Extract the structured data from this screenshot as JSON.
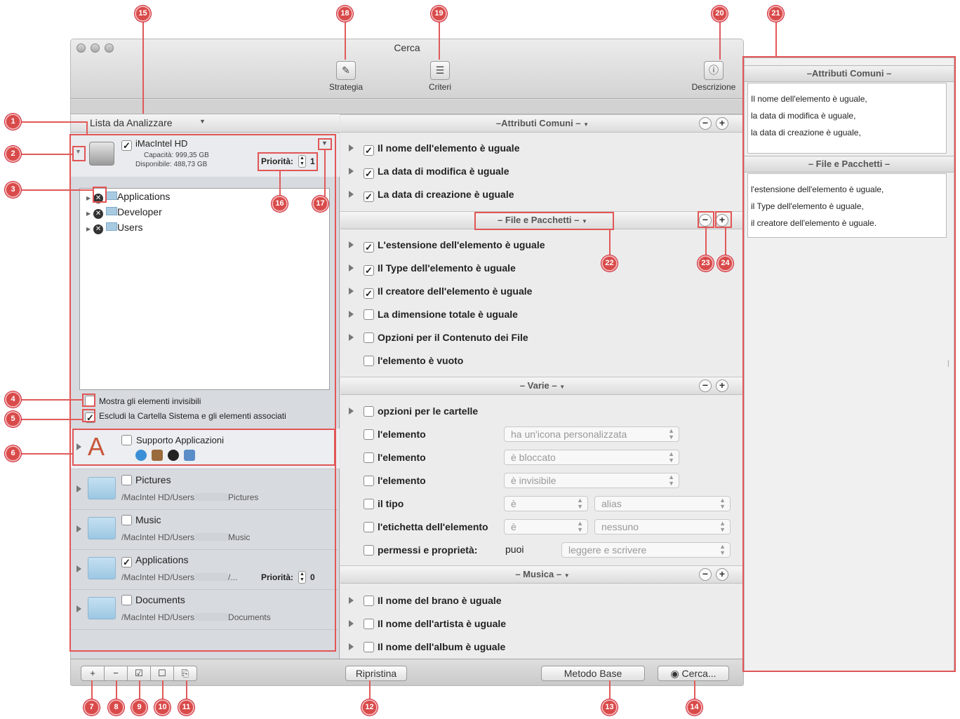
{
  "window": {
    "title": "Cerca"
  },
  "toolbar": {
    "strategia": "Strategia",
    "criteri": "Criteri",
    "descrizione": "Descrizione"
  },
  "left": {
    "header": "Lista da Analizzare",
    "volume": {
      "name": "iMacIntel HD",
      "capacity": "Capacità: 999,35 GB",
      "available": "Disponibile: 488,73 GB",
      "priority_label": "Priorità:",
      "priority_value": "1"
    },
    "tree": [
      {
        "label": "Applications"
      },
      {
        "label": "Developer"
      },
      {
        "label": "Users"
      }
    ],
    "show_invisible": "Mostra gli elementi invisibili",
    "exclude_system": "Escludi la Cartella Sistema e gli elementi associati",
    "support_apps": "Supporto Applicazioni",
    "folders": [
      {
        "name": "Pictures",
        "path_start": "/MacIntel HD/Users",
        "path_end": "Pictures",
        "checked": false
      },
      {
        "name": "Music",
        "path_start": "/MacIntel HD/Users",
        "path_end": "Music",
        "checked": false
      },
      {
        "name": "Applications",
        "path_start": "/MacIntel HD/Users",
        "path_end": "/...",
        "checked": true,
        "priority_label": "Priorità:",
        "priority_value": "0"
      },
      {
        "name": "Documents",
        "path_start": "/MacIntel HD/Users",
        "path_end": "Documents",
        "checked": false
      }
    ]
  },
  "criteria": {
    "common": {
      "title": "–Attributi Comuni –",
      "items": [
        "Il nome dell'elemento è uguale",
        "La data di modifica è uguale",
        "La data di creazione è uguale"
      ]
    },
    "files": {
      "title": "– File e Pacchetti –",
      "items": [
        "L'estensione dell'elemento è uguale",
        "Il Type dell'elemento è uguale",
        "Il creatore dell'elemento è uguale",
        "La dimensione totale è uguale",
        "Opzioni per il Contenuto dei File",
        "l'elemento è vuoto"
      ]
    },
    "misc": {
      "title": "– Varie –",
      "folders": "opzioni per le cartelle",
      "item_label": "l'elemento",
      "custom_icon": "ha un'icona personalizzata",
      "locked": "è bloccato",
      "invisible": "è invisibile",
      "type_label": "il tipo",
      "is": "è",
      "alias": "alias",
      "tag_label": "l'etichetta dell'elemento",
      "none": "nessuno",
      "perms_label": "permessi e proprietà:",
      "can": "puoi",
      "read_write": "leggere e scrivere"
    },
    "music": {
      "title": "– Musica –",
      "items": [
        "Il nome del brano è uguale",
        "Il nome dell'artista è uguale",
        "Il nome dell'album è uguale"
      ]
    }
  },
  "bottom": {
    "reset": "Ripristina",
    "base": "Metodo Base",
    "search": "Cerca..."
  },
  "description": {
    "common_title": "–Attributi Comuni –",
    "common_lines": [
      "Il nome dell'elemento è uguale,",
      "la data di modifica è uguale,",
      "la data di creazione è uguale,"
    ],
    "files_title": "– File e Pacchetti –",
    "files_lines": [
      "l'estensione dell'elemento è uguale,",
      "il Type dell'elemento è uguale,",
      "il creatore dell'elemento è uguale."
    ]
  },
  "callouts": [
    "1",
    "2",
    "3",
    "4",
    "5",
    "6",
    "7",
    "8",
    "9",
    "10",
    "11",
    "12",
    "13",
    "14",
    "15",
    "16",
    "17",
    "18",
    "19",
    "20",
    "21",
    "22",
    "23",
    "24"
  ],
  "colors": {
    "callout": "#d94a4a",
    "accent": "#e25555"
  }
}
